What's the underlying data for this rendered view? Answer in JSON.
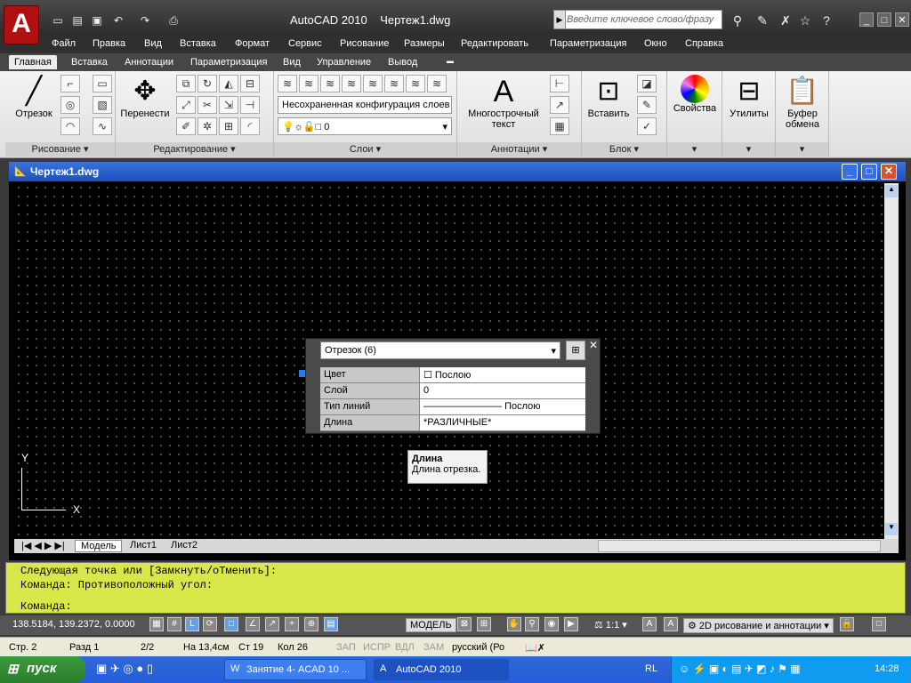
{
  "app": {
    "logo": "A",
    "title": "AutoCAD 2010",
    "filename": "Чертеж1.dwg",
    "search_placeholder": "Введите ключевое слово/фразу"
  },
  "menu": [
    "Файл",
    "Правка",
    "Вид",
    "Вставка",
    "Формат",
    "Сервис",
    "Рисование",
    "Размеры",
    "Редактировать",
    "Параметризация",
    "Окно",
    "Справка"
  ],
  "ribbon_tabs": [
    "Главная",
    "Вставка",
    "Аннотации",
    "Параметризация",
    "Вид",
    "Управление",
    "Вывод"
  ],
  "ribbon_panels": {
    "draw": {
      "label": "Рисование",
      "big_button": "Отрезок"
    },
    "modify": {
      "label": "Редактирование",
      "big_button": "Перенести"
    },
    "layers": {
      "label": "Слои",
      "layer_state": "Несохраненная конфигурация слоев",
      "current_layer": "0"
    },
    "annotation": {
      "label": "Аннотации",
      "big_button": "Многострочный текст"
    },
    "block": {
      "label": "Блок",
      "big_button": "Вставить"
    },
    "properties": {
      "label": "Свойства"
    },
    "utilities": {
      "label": "Утилиты"
    },
    "clipboard": {
      "label": "Буфер обмена"
    }
  },
  "document": {
    "title": "Чертеж1.dwg"
  },
  "layout_tabs": [
    "Модель",
    "Лист1",
    "Лист2"
  ],
  "axis": {
    "y": "Y",
    "x": "X"
  },
  "properties_palette": {
    "selection": "Отрезок (6)",
    "rows": [
      {
        "key": "Цвет",
        "value": "Послою"
      },
      {
        "key": "Слой",
        "value": "0"
      },
      {
        "key": "Тип линий",
        "value": "Послою"
      },
      {
        "key": "Длина",
        "value": "*РАЗЛИЧНЫЕ*"
      }
    ]
  },
  "tooltip": {
    "title": "Длина",
    "text": "Длина отрезка."
  },
  "command_lines": [
    "Следующая точка или [Замкнуть/оТменить]:",
    "Команда: Противоположный угол:",
    "Команда:"
  ],
  "status": {
    "coords": "138.5184, 139.2372, 0.0000",
    "model": "МОДЕЛЬ",
    "scale": "1:1",
    "workspace": "2D рисование и аннотации"
  },
  "word_status": {
    "page": "Стр. 2",
    "section": "Разд 1",
    "pages": "2/2",
    "at": "На 13,4см",
    "line": "Ст 19",
    "col": "Кол 26",
    "rec": "ЗАП",
    "track": "ИСПР",
    "ext": "ВДЛ",
    "ovr": "ЗАМ",
    "lang": "русский (Ро"
  },
  "taskbar": {
    "start": "пуск",
    "tasks": [
      "Занятие 4- ACAD 10 ...",
      "AutoCAD 2010"
    ],
    "lang": "RL",
    "clock": "14:28"
  }
}
